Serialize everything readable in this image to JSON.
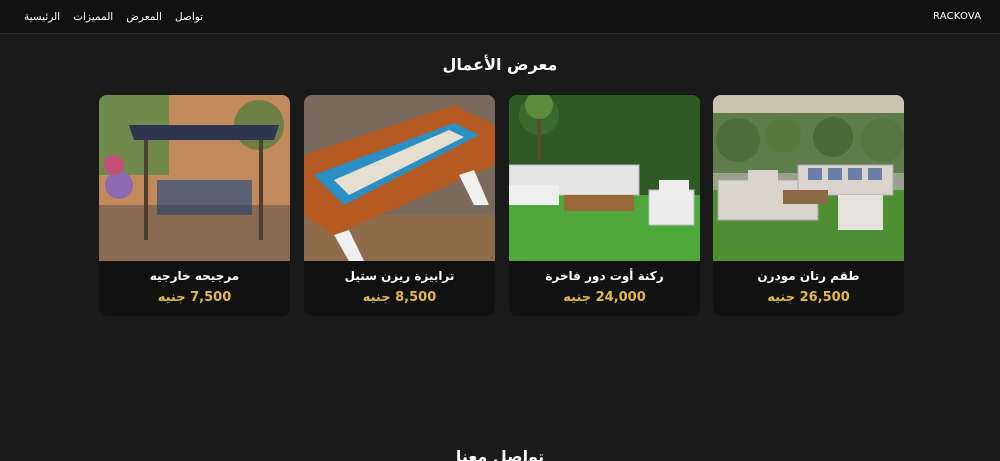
{
  "nav": {
    "brand": "RACKOVA",
    "links": [
      "الرئيسية",
      "المميزات",
      "المعرض",
      "تواصل"
    ]
  },
  "gallery": {
    "title": "معرض الأعمال",
    "items": [
      {
        "name": "طقم رتان مودرن",
        "price": "26,500 جنيه",
        "image": "rattan-outdoor-sofa-set-photo"
      },
      {
        "name": "ركنة أوت دور فاخرة",
        "price": "24,000 جنيه",
        "image": "outdoor-corner-sofa-photo"
      },
      {
        "name": "ترابيزة ريزن ستيل",
        "price": "8,500 جنيه",
        "image": "resin-river-table-photo"
      },
      {
        "name": "مرجيحه خارجيه",
        "price": "7,500 جنيه",
        "image": "outdoor-swing-photo"
      }
    ]
  },
  "contact": {
    "title": "تواصل معنا"
  },
  "colors": {
    "background": "#1a1a1a",
    "card": "#111111",
    "price": "#e0b94a"
  }
}
